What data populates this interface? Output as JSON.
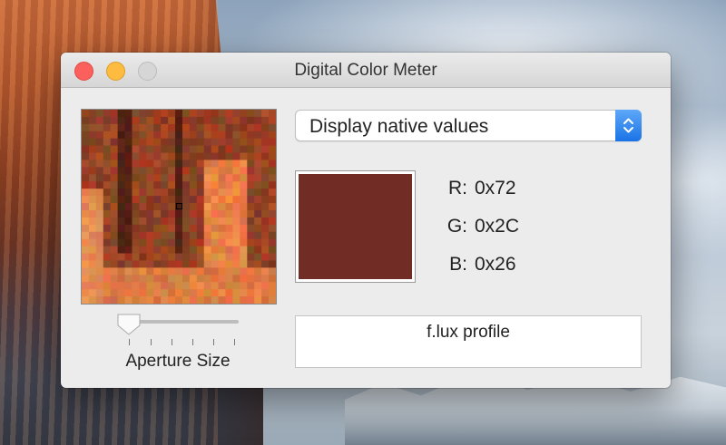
{
  "window": {
    "title": "Digital Color Meter",
    "controls": [
      "close",
      "minimize",
      "zoom"
    ]
  },
  "magnifier": {
    "aperture_label": "Aperture Size",
    "aperture_level": 0.0
  },
  "display_mode": {
    "selected": "Display native values",
    "icon": "chevron-up-down-icon"
  },
  "color": {
    "swatch_hex": "#722C26",
    "rows": [
      {
        "label": "R:",
        "value": "0x72"
      },
      {
        "label": "G:",
        "value": "0x2C"
      },
      {
        "label": "B:",
        "value": "0x26"
      }
    ]
  },
  "profile": {
    "name": "f.lux profile"
  },
  "colors": {
    "close": "#FC605C",
    "minimize": "#FDBC40",
    "zoom_inactive": "#D6D6D6",
    "accent": "#1A73E6"
  }
}
